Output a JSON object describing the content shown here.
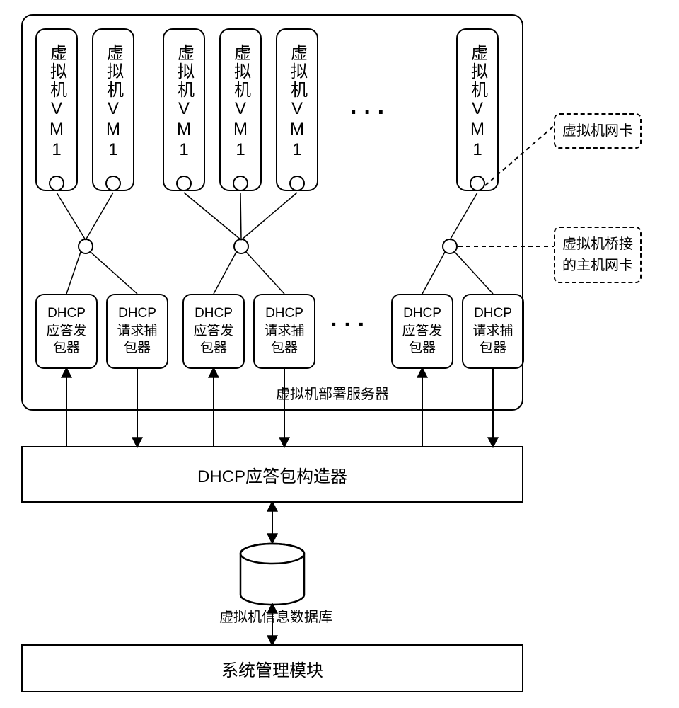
{
  "server": {
    "label": "虚拟机部署服务器"
  },
  "vm": {
    "label": "虚拟机VM1"
  },
  "dhcp": {
    "resp": "DHCP\n应答发\n包器",
    "req": "DHCP\n请求捕\n包器"
  },
  "constructor_box": "DHCP应答包构造器",
  "db_label": "虚拟机信息数据库",
  "mgmt_box": "系统管理模块",
  "side": {
    "nic": "虚拟机网卡",
    "host": "虚拟机桥接\n的主机网卡"
  }
}
